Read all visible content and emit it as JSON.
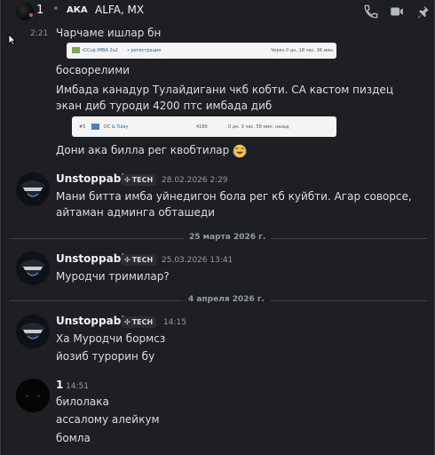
{
  "header": {
    "name": "1",
    "separator": "•",
    "aka_label": "АКА",
    "alias": "ALFA, MX",
    "icons": [
      "phone-icon",
      "pin-icon",
      "video-icon",
      "pushpin-icon"
    ]
  },
  "messages": {
    "m1": {
      "time": "2:21",
      "text": "Чарчаме ишлар бн"
    },
    "embed1": {
      "name": "iCCup IMBA 2x2",
      "link": "• регистрация",
      "right": "Через 0 дн. 18 час. 36 мин."
    },
    "m2": {
      "text": "босворелими"
    },
    "m3": {
      "text": "Имбада канадур Тулайдигани чкб кобти. CA кастом пиздец экан диб туроди 4200 птс имбада диб"
    },
    "embed2": {
      "rank": "#5",
      "players": "DC & Tulay",
      "pts": "4180",
      "ago": "0 дн. 3 час. 58 мин. назад"
    },
    "m4": {
      "text": "Дони ака билла рег квобтилар"
    },
    "emoji": "joy-emoji"
  },
  "group1": {
    "author": "Unstoppable",
    "tag": "TECH",
    "date": "28.02.2026 2:29",
    "text": "Мани битта имба уйнедигон бола рег кб куйбти. Агар соворсе, айтаман админга обташеди"
  },
  "divider1": "25 марта 2026 г.",
  "group2": {
    "author": "Unstoppable",
    "tag": "TECH",
    "date": "25.03.2026 13:41",
    "text": "Муродчи тримилар?"
  },
  "divider2": "4 апреля 2026 г.",
  "group3": {
    "author": "Unstoppable",
    "tag": "TECH",
    "date": "14:15",
    "line1": "Ха Муродчи бормсз",
    "line2": "йозиб турорин бу"
  },
  "group4": {
    "author": "1",
    "date": "14:51",
    "line1": "билолака",
    "line2": "ассалому алейкум",
    "line3": "бомла"
  },
  "colors": {
    "background": "#1e1f22",
    "text": "#dbdee1",
    "muted": "#949ba4",
    "tag_bg": "#2b2d31"
  }
}
